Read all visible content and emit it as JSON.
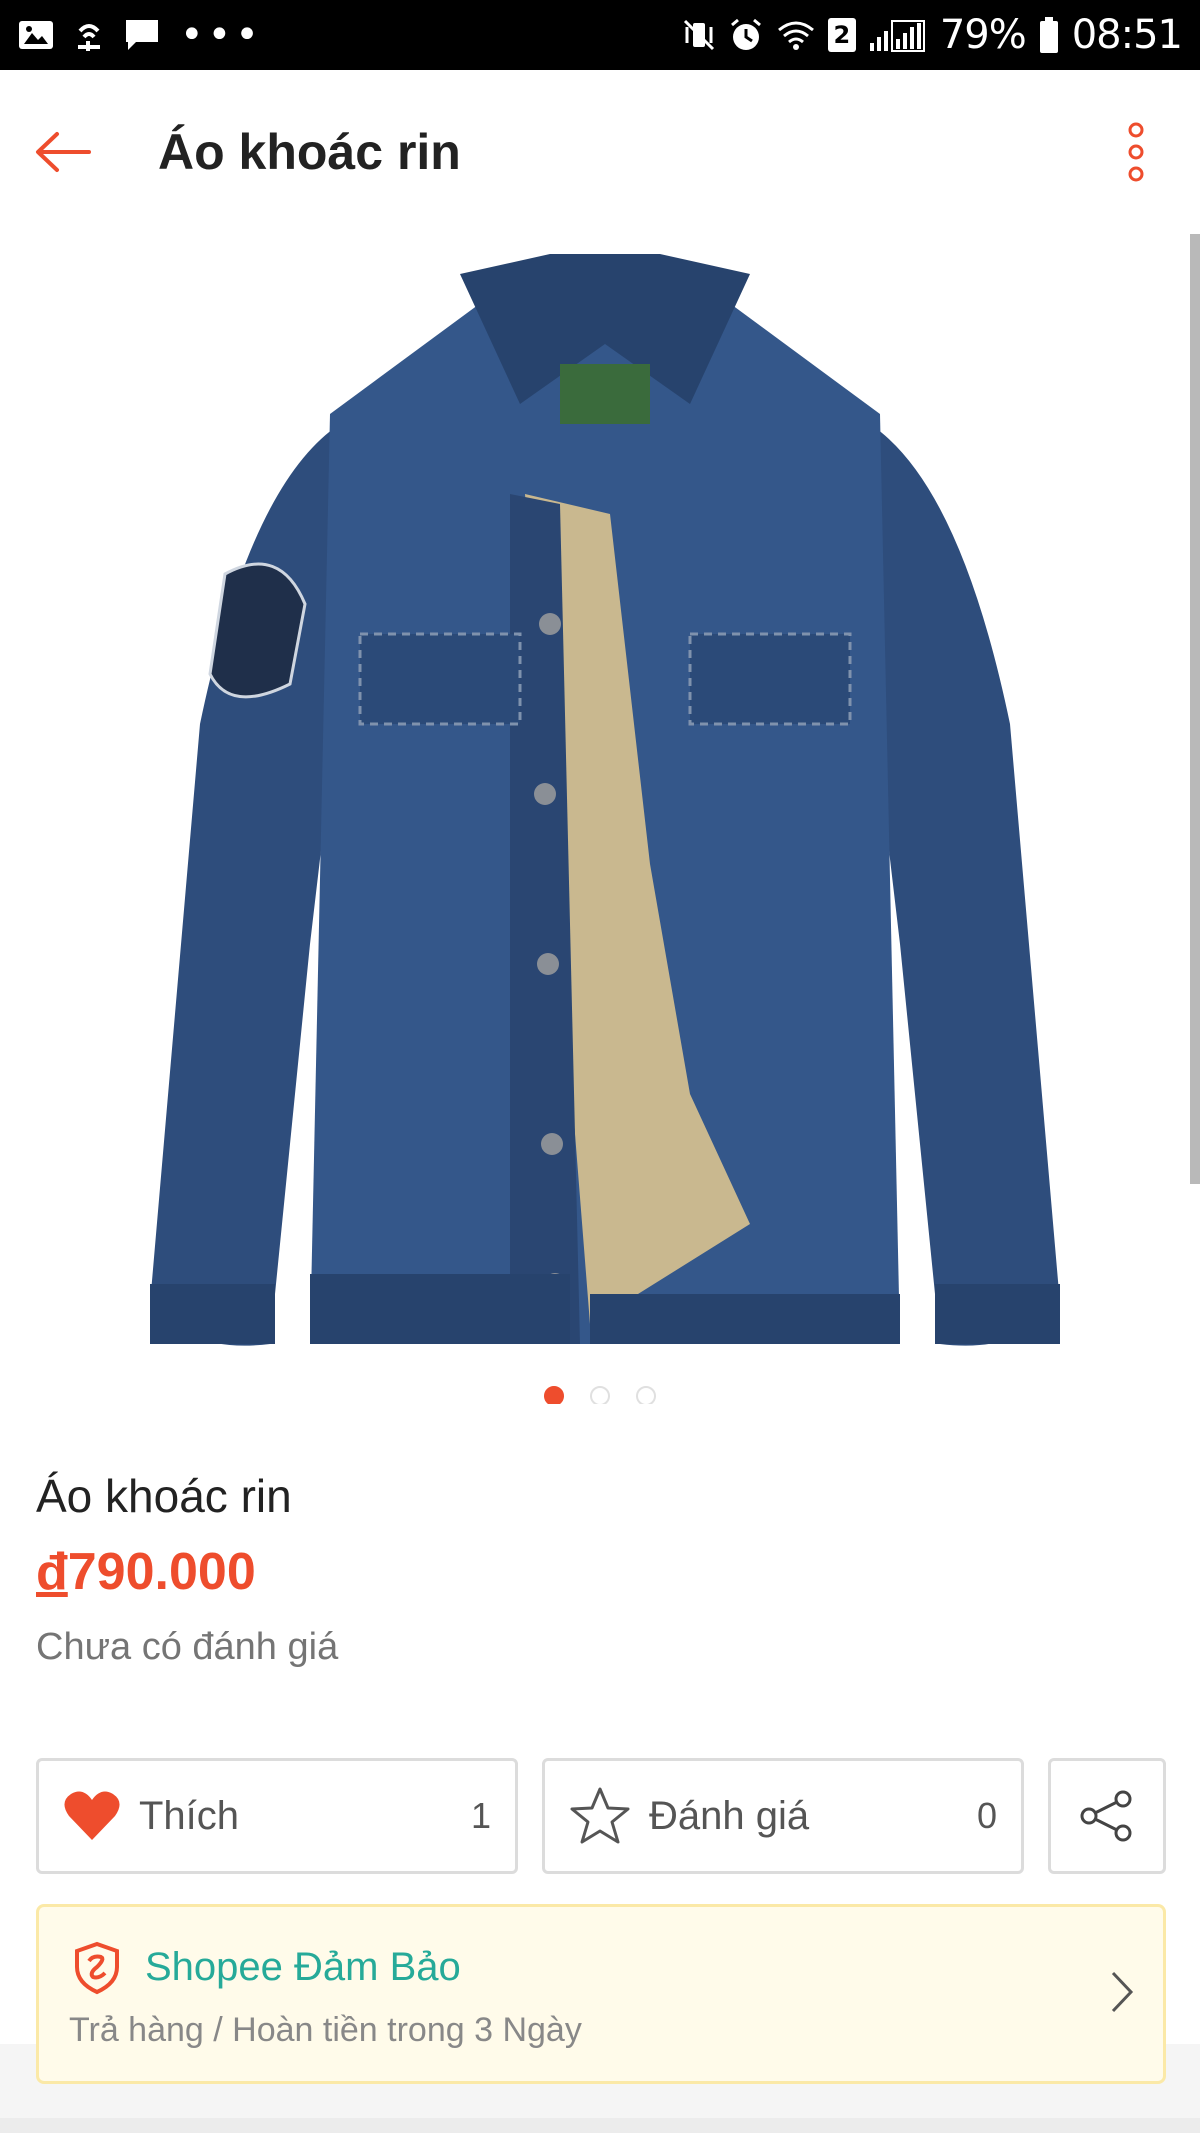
{
  "status_bar": {
    "battery": "79%",
    "time": "08:51",
    "sim_badge": "2",
    "icons": [
      "gallery-icon",
      "wifi-assistant-icon",
      "message-icon",
      "more-dots-icon",
      "vibrate-mute-icon",
      "alarm-icon",
      "wifi-icon",
      "signal-icon",
      "battery-icon"
    ]
  },
  "app_bar": {
    "title": "Áo khoác rin",
    "back_icon": "arrow-left-icon",
    "menu_icon": "more-vertical-icon"
  },
  "gallery": {
    "image_alt": "Denim jacket with sherpa lining",
    "page_count": 3,
    "active_index": 0
  },
  "product": {
    "name": "Áo khoác rin",
    "price_currency": "đ",
    "price_value": "790.000",
    "rating_text": "Chưa có đánh giá"
  },
  "actions": {
    "like_label": "Thích",
    "like_count": "1",
    "review_label": "Đánh giá",
    "review_count": "0"
  },
  "guarantee": {
    "title": "Shopee Đảm Bảo",
    "subtitle": "Trả hàng / Hoàn tiền trong 3 Ngày"
  },
  "colors": {
    "brand": "#ee4d2d",
    "guarantee_green": "#26aa99",
    "denim": "#2b4a78"
  }
}
